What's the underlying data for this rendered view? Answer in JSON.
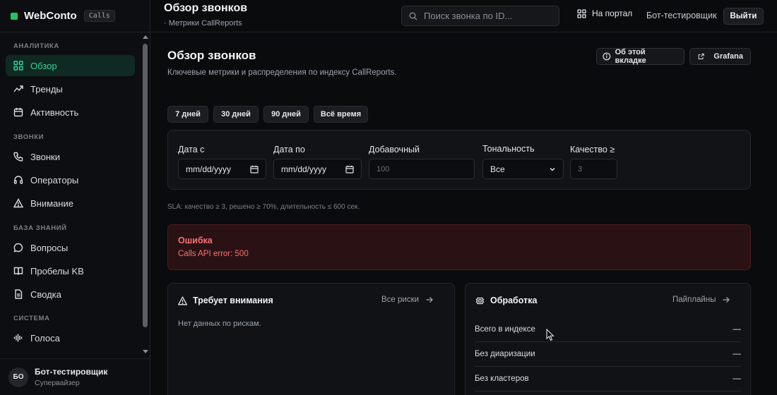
{
  "brand": {
    "name": "WebConto",
    "tag": "Calls"
  },
  "sidebar": {
    "sections": [
      {
        "label": "АНАЛИТИКА",
        "items": [
          {
            "label": "Обзор",
            "icon": "grid-icon",
            "active": true
          },
          {
            "label": "Тренды",
            "icon": "trend-icon"
          },
          {
            "label": "Активность",
            "icon": "calendar-icon"
          }
        ]
      },
      {
        "label": "ЗВОНКИ",
        "items": [
          {
            "label": "Звонки",
            "icon": "phone-icon"
          },
          {
            "label": "Операторы",
            "icon": "headset-icon"
          },
          {
            "label": "Внимание",
            "icon": "warning-icon"
          }
        ]
      },
      {
        "label": "БАЗА ЗНАНИЙ",
        "items": [
          {
            "label": "Вопросы",
            "icon": "chat-icon"
          },
          {
            "label": "Пробелы KB",
            "icon": "book-icon"
          },
          {
            "label": "Сводка",
            "icon": "document-icon"
          }
        ]
      },
      {
        "label": "СИСТЕМА",
        "items": [
          {
            "label": "Голоса",
            "icon": "audio-wave-icon"
          }
        ]
      }
    ],
    "user": {
      "initials": "БО",
      "name": "Бот-тестировщик",
      "role": "Супервайзер"
    }
  },
  "topbar": {
    "title": "Обзор звонков",
    "subtitle": "· Метрики CallReports",
    "search_placeholder": "Поиск звонка по ID...",
    "portal_label": "На портал",
    "user_label": "Бот-тестировщик",
    "logout_label": "Выйти"
  },
  "page": {
    "title": "Обзор звонков",
    "description": "Ключевые метрики и распределения по индексу CallReports.",
    "about_label": "Об этой вкладке",
    "grafana_label": "Grafana",
    "ranges": [
      "7 дней",
      "30 дней",
      "90 дней",
      "Всё время"
    ]
  },
  "filters": {
    "date_from": {
      "label": "Дата с",
      "value": "mm/dd/yyyy"
    },
    "date_to": {
      "label": "Дата по",
      "value": "mm/dd/yyyy"
    },
    "extension": {
      "label": "Добавочный",
      "placeholder": "100"
    },
    "tone": {
      "label": "Тональность",
      "value": "Все"
    },
    "quality": {
      "label": "Качество ≥",
      "placeholder": "3"
    }
  },
  "sla_text": "SLA: качество ≥ 3, решено ≥ 70%, длительность ≤ 600 сек.",
  "error": {
    "title": "Ошибка",
    "message": "Calls API error: 500"
  },
  "attention_panel": {
    "title": "Требует внимания",
    "link": "Все риски",
    "empty": "Нет данных по рискам."
  },
  "processing_panel": {
    "title": "Обработка",
    "link": "Пайплайны",
    "rows": [
      {
        "label": "Всего в индексе",
        "value": "—"
      },
      {
        "label": "Без диаризации",
        "value": "—"
      },
      {
        "label": "Без кластеров",
        "value": "—"
      }
    ]
  },
  "colors": {
    "accent": "#34d399",
    "brand": "#22c55e",
    "error": "#f87171",
    "background": "#0a0b0d"
  }
}
